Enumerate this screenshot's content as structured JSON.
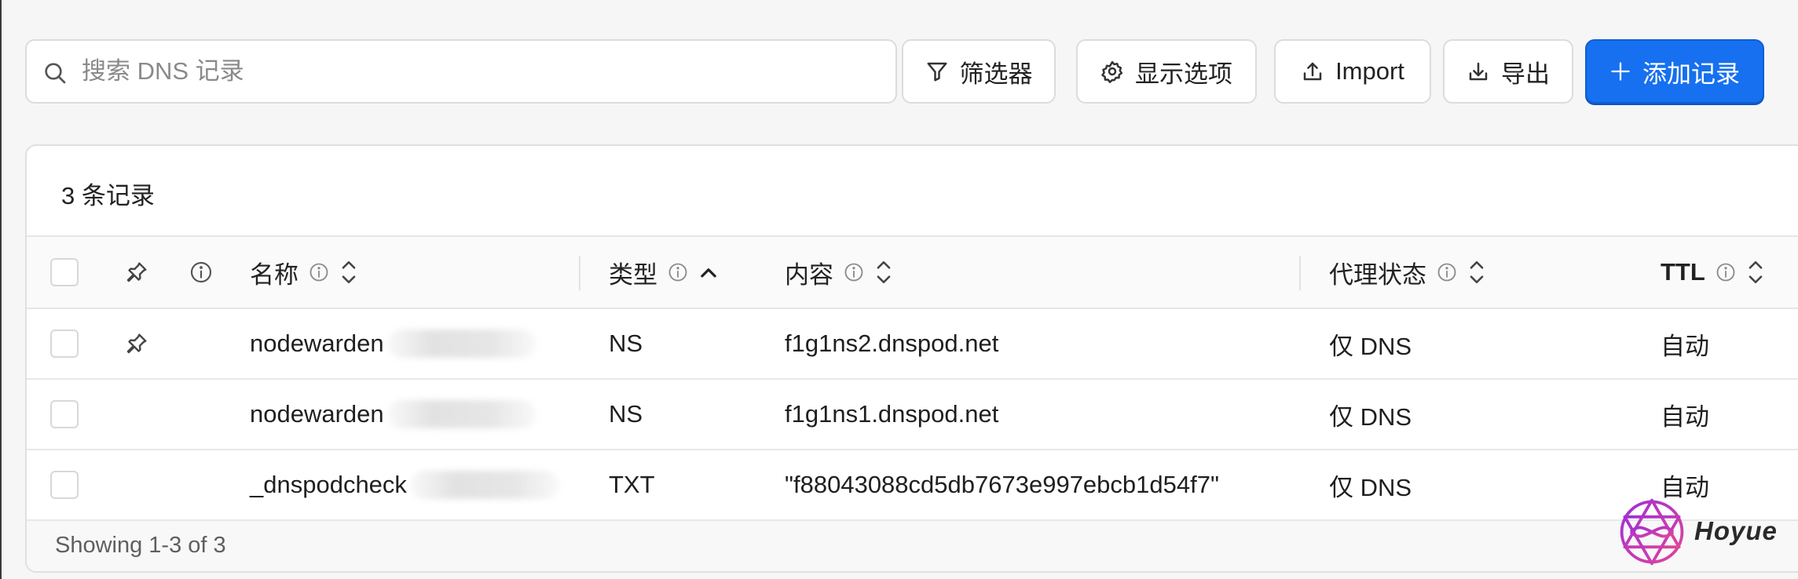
{
  "toolbar": {
    "search_placeholder": "搜索 DNS 记录",
    "filter_label": "筛选器",
    "display_options_label": "显示选项",
    "import_label": "Import",
    "export_label": "导出",
    "add_record_label": "添加记录"
  },
  "records_count_text": "3 条记录",
  "table": {
    "columns": {
      "name": "名称",
      "type": "类型",
      "content": "内容",
      "proxy_status": "代理状态",
      "ttl": "TTL"
    },
    "sort": {
      "column": "type",
      "direction": "ascending"
    },
    "rows": [
      {
        "name": "nodewarden",
        "type": "NS",
        "content": "f1g1ns2.dnspod.net",
        "proxy_status": "仅 DNS",
        "ttl": "自动",
        "pinned": true
      },
      {
        "name": "nodewarden",
        "type": "NS",
        "content": "f1g1ns1.dnspod.net",
        "proxy_status": "仅 DNS",
        "ttl": "自动",
        "pinned": false
      },
      {
        "name": "_dnspodcheck",
        "type": "TXT",
        "content": "\"f88043088cd5db7673e997ebcb1d54f7\"",
        "proxy_status": "仅 DNS",
        "ttl": "自动",
        "pinned": false
      }
    ]
  },
  "footer": {
    "showing_text": "Showing 1-3 of 3"
  },
  "watermark": {
    "text": "Hoyue",
    "icon": "hoyue-logo-icon"
  },
  "colors": {
    "primary": "#1670f0",
    "border": "#dcdcdc",
    "watermark_purple": "#a12fd8",
    "watermark_pink": "#e0459a"
  }
}
